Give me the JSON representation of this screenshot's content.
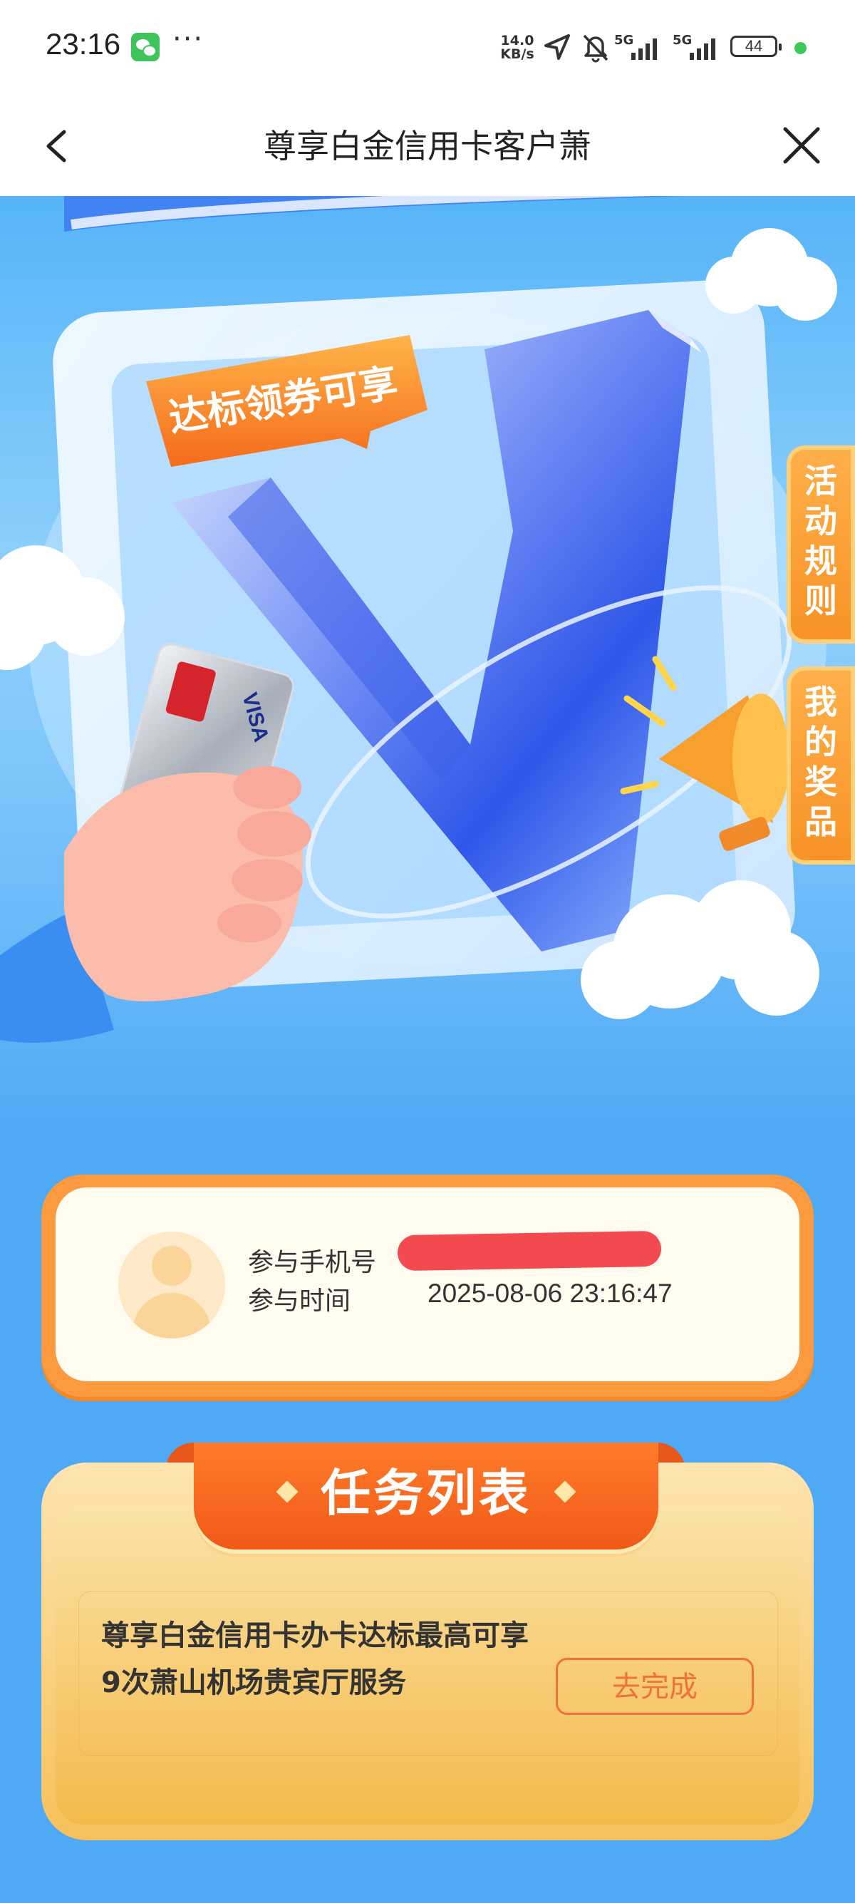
{
  "status_bar": {
    "time": "23:16",
    "more": "···",
    "network_speed_value": "14.0",
    "network_speed_unit": "KB/s",
    "sim1_label": "5G",
    "sim2_label": "5G",
    "battery": "44",
    "icons": [
      "wechat-icon",
      "location-arrow-icon",
      "bell-muted-icon",
      "signal-icon",
      "battery-icon"
    ]
  },
  "navbar": {
    "title": "尊享白金信用卡客户萧"
  },
  "hero": {
    "badge_text": "达标领券可享",
    "side_tabs": [
      {
        "label": "活动规则"
      },
      {
        "label": "我的奖品"
      }
    ],
    "card_brand": "VISA"
  },
  "user_card": {
    "phone_label": "参与手机号",
    "time_label": "参与时间",
    "time_value": "2025-08-06 23:16:47"
  },
  "tasks": {
    "title": "任务列表",
    "items": [
      {
        "description": "尊享白金信用卡办卡达标最高可享9次萧山机场贵宾厅服务",
        "button_label": "去完成"
      }
    ]
  },
  "colors": {
    "accent_orange": "#f0713a",
    "page_blue": "#4fa9f5",
    "redaction_red": "#f24a4f"
  }
}
